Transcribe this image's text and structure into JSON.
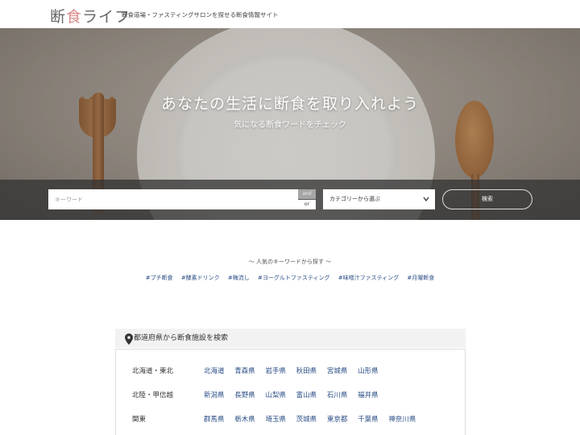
{
  "header": {
    "logo_text_1": "断",
    "logo_text_2": "食",
    "logo_text_3": "ライフ",
    "tagline": "断食道場・ファスティングサロンを探せる断食情報サイト"
  },
  "hero": {
    "title": "あなたの生活に断食を取り入れよう",
    "subtitle": "気になる断食ワードをチェック"
  },
  "search": {
    "keyword_placeholder": "キーワード",
    "and_label": "and",
    "or_label": "or",
    "category_label": "カテゴリーから選ぶ",
    "submit_label": "検索"
  },
  "popular": {
    "title": "～ 人気のキーワードから探す ～",
    "tags": [
      "#プチ断食",
      "#酵素ドリンク",
      "#梅流し",
      "#ヨーグルトファスティング",
      "#味噌汁ファスティング",
      "#月曜断食"
    ]
  },
  "prefectures": {
    "heading": "都道府県から断食施設を検索",
    "rows": [
      {
        "region": "北海道・東北",
        "prefs": [
          "北海道",
          "青森県",
          "岩手県",
          "秋田県",
          "宮城県",
          "山形県"
        ]
      },
      {
        "region": "北陸・甲信越",
        "prefs": [
          "新潟県",
          "長野県",
          "山梨県",
          "富山県",
          "石川県",
          "福井県"
        ]
      },
      {
        "region": "関東",
        "prefs": [
          "群馬県",
          "栃木県",
          "埼玉県",
          "茨城県",
          "東京都",
          "千葉県",
          "神奈川県"
        ]
      }
    ]
  },
  "colors": {
    "link": "#2a4e86",
    "logo_accent": "#d98a8a"
  }
}
